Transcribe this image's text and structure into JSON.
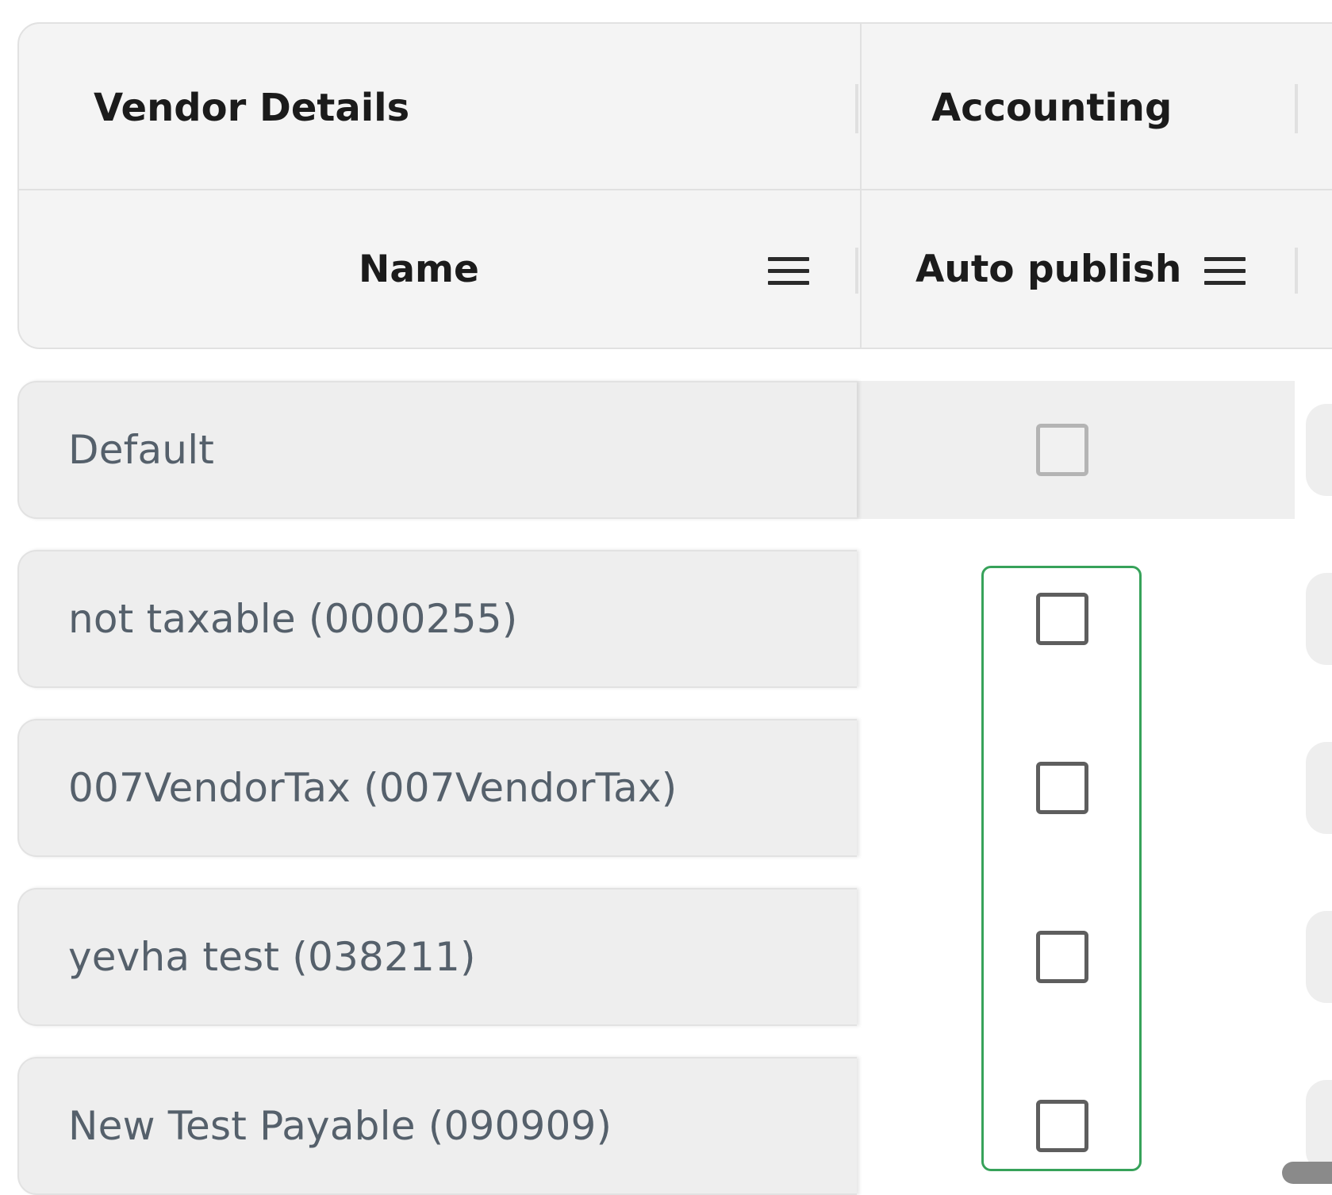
{
  "header": {
    "groups": {
      "vendor_details": "Vendor Details",
      "accounting": "Accounting"
    },
    "columns": {
      "name": "Name",
      "auto_publish": "Auto publish"
    }
  },
  "rows": [
    {
      "name": "Default",
      "auto_publish": false,
      "auto_publish_disabled": true
    },
    {
      "name": "not taxable (0000255)",
      "auto_publish": false,
      "auto_publish_disabled": false
    },
    {
      "name": "007VendorTax (007VendorTax)",
      "auto_publish": false,
      "auto_publish_disabled": false
    },
    {
      "name": "yevha test (038211)",
      "auto_publish": false,
      "auto_publish_disabled": false
    },
    {
      "name": "New Test Payable (090909)",
      "auto_publish": false,
      "auto_publish_disabled": false
    }
  ],
  "colors": {
    "focus": "#37a25a",
    "text_primary": "#1b1b1b",
    "text_cell": "#55606b"
  },
  "icons": {
    "column_menu": "hamburger-menu-icon",
    "checkbox": "checkbox-unchecked"
  }
}
